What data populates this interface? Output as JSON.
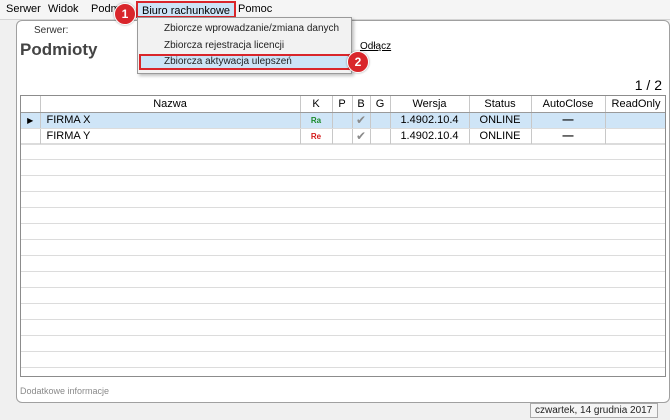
{
  "menubar": {
    "items": [
      "Serwer",
      "Widok",
      "Podmi",
      "Biuro rachunkowe",
      "Pomoc"
    ]
  },
  "dropdown": {
    "items": [
      "Zbiorcze wprowadzanie/zmiana danych",
      "Zbiorcza rejestracja licencji",
      "Zbiorcza aktywacja ulepszeń"
    ]
  },
  "callouts": [
    "1",
    "2"
  ],
  "header": {
    "server_label": "Serwer:",
    "odlacz": "Odłącz",
    "title": "Podmioty",
    "page_counter": "1 / 2"
  },
  "grid": {
    "columns": [
      "Nazwa",
      "K",
      "P",
      "B",
      "G",
      "Wersja",
      "Status",
      "AutoClose",
      "ReadOnly"
    ],
    "rows": [
      {
        "name": "FIRMA X",
        "k": "Ra",
        "k_color": "#1a8a2a",
        "b": "✔",
        "version": "1.4902.10.4",
        "status": "ONLINE",
        "autoclose": "—",
        "selected": true
      },
      {
        "name": "FIRMA Y",
        "k": "Re",
        "k_color": "#d41a1a",
        "b": "✔",
        "version": "1.4902.10.4",
        "status": "ONLINE",
        "autoclose": "—",
        "selected": false
      }
    ]
  },
  "footer": {
    "info": "Dodatkowe informacje",
    "date": "czwartek, 14 grudnia 2017"
  },
  "colors": {
    "highlight_border": "#d9262b",
    "selection": "#cfe5f7"
  }
}
